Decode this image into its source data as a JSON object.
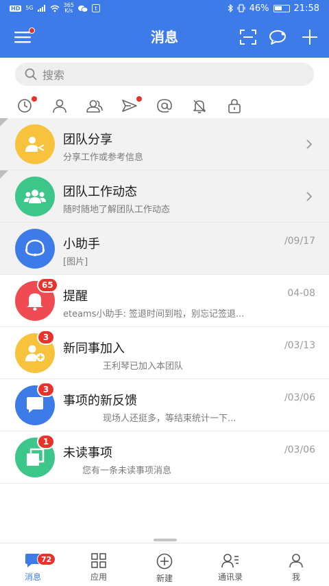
{
  "status_bar": {
    "network": "HD",
    "signal": "5G",
    "speed_value": "365",
    "speed_unit": "K/s",
    "battery": "46%",
    "time": "21:58"
  },
  "header": {
    "title": "消息",
    "menu_icon": "menu-icon",
    "scan_icon": "scan-icon",
    "chat_icon": "chat-bubble-icon",
    "add_icon": "plus-icon"
  },
  "search": {
    "placeholder": "搜索"
  },
  "filters": [
    {
      "icon": "recent-clock-icon",
      "dot": true
    },
    {
      "icon": "person-icon",
      "dot": false
    },
    {
      "icon": "group-icon",
      "dot": false
    },
    {
      "icon": "send-icon",
      "dot": true
    },
    {
      "icon": "at-icon",
      "dot": false
    },
    {
      "icon": "mute-bell-icon",
      "dot": false
    },
    {
      "icon": "lock-icon",
      "dot": false
    }
  ],
  "messages": [
    {
      "name": "团队分享",
      "subtitle": "分享工作或参考信息",
      "date": "",
      "badge": "",
      "color": "#f7c23c",
      "icon": "share-person-icon"
    },
    {
      "name": "团队工作动态",
      "subtitle": "随时随地了解团队工作动态",
      "date": "",
      "badge": "",
      "color": "#3cc68a",
      "icon": "team-icon"
    },
    {
      "name": "小助手",
      "subtitle": "[图片]",
      "date": "/09/17",
      "badge": "",
      "color": "#3d7be8",
      "icon": "headset-icon"
    },
    {
      "name": "提醒",
      "subtitle": "eteams小助手: 签退时间到啦，别忘记签退...",
      "date": "04-08",
      "badge": "65",
      "color": "#f04a52",
      "icon": "bell-icon"
    },
    {
      "name": "新同事加入",
      "subtitle": "王利琴已加入本团队",
      "date": "/03/13",
      "badge": "3",
      "color": "#f7c23c",
      "icon": "add-user-icon"
    },
    {
      "name": "事项的新反馈",
      "subtitle": "现场人还挺多，等结束统计一下...",
      "date": "/03/06",
      "badge": "3",
      "color": "#3d7be8",
      "icon": "comment-icon"
    },
    {
      "name": "未读事项",
      "subtitle": "您有一条未读事项消息",
      "date": "/03/06",
      "badge": "1",
      "color": "#3cc68a",
      "icon": "unread-item-icon"
    }
  ],
  "tabs": [
    {
      "label": "消息",
      "icon": "message-tab-icon",
      "badge": "72",
      "active": true
    },
    {
      "label": "应用",
      "icon": "apps-grid-icon",
      "badge": "",
      "active": false
    },
    {
      "label": "新建",
      "icon": "new-circle-plus-icon",
      "badge": "",
      "active": false
    },
    {
      "label": "通讯录",
      "icon": "contacts-icon",
      "badge": "",
      "active": false
    },
    {
      "label": "我",
      "icon": "me-person-icon",
      "badge": "",
      "active": false
    }
  ],
  "colors": {
    "brand": "#3d7be8",
    "badge": "#e8322c"
  }
}
